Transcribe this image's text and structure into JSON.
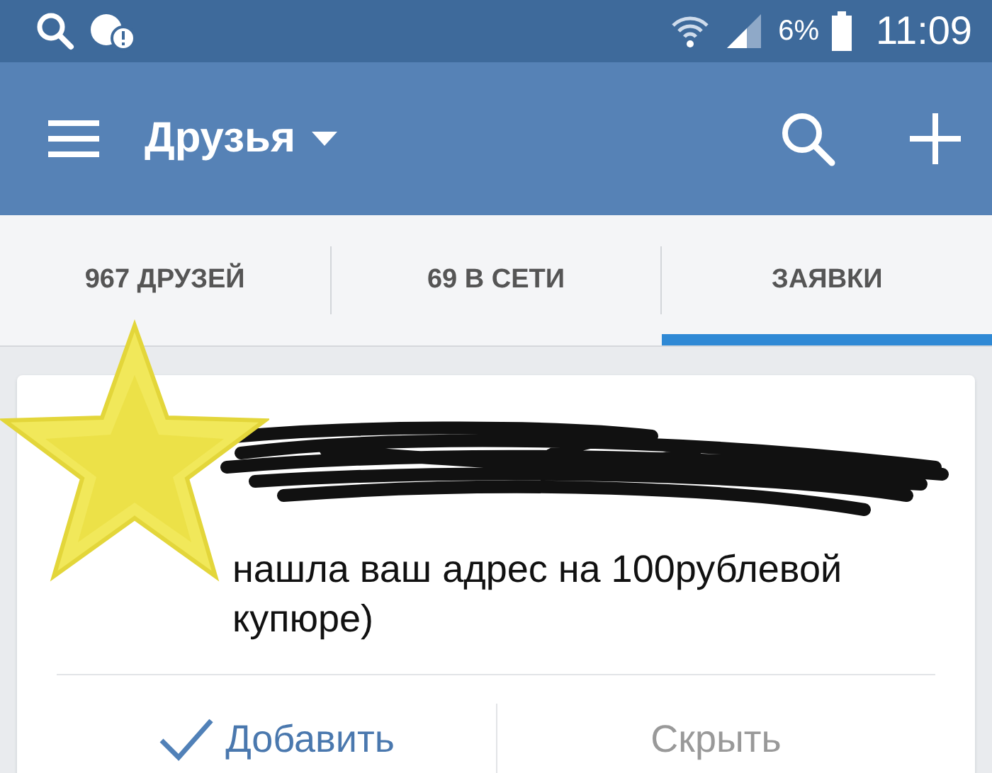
{
  "status_bar": {
    "battery": "6%",
    "time": "11:09"
  },
  "toolbar": {
    "title": "Друзья"
  },
  "tabs": [
    {
      "label": "967 ДРУЗЕЙ",
      "selected": false
    },
    {
      "label": "69 В СЕТИ",
      "selected": false
    },
    {
      "label": "ЗАЯВКИ",
      "selected": true
    }
  ],
  "request": {
    "message": "нашла ваш адрес на 100рублевой купюре)",
    "actions": [
      {
        "label": "Добавить",
        "kind": "accept"
      },
      {
        "label": "Скрыть",
        "kind": "hide"
      }
    ]
  }
}
